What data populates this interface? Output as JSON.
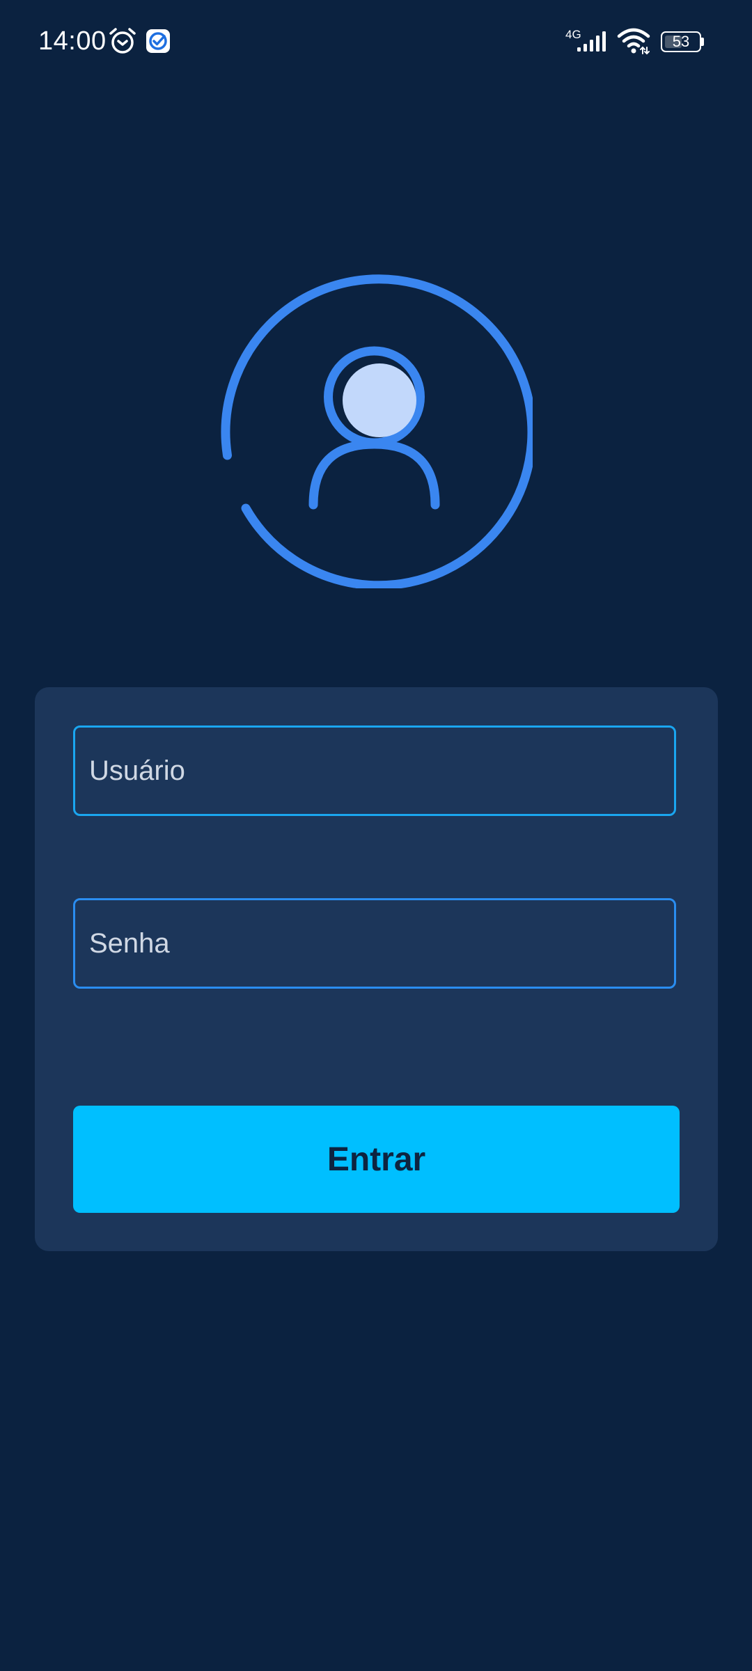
{
  "status_bar": {
    "time": "14:00",
    "network": "4G",
    "battery": 53,
    "icons": [
      "alarm-icon",
      "task-check-icon",
      "signal-icon",
      "wifi-icon",
      "battery-icon"
    ]
  },
  "avatar": {
    "icon": "user-profile-icon",
    "ring_color": "#3a86f0",
    "fill_color": "#c2d8fb"
  },
  "login_form": {
    "username_placeholder": "Usuário",
    "password_placeholder": "Senha",
    "submit_label": "Entrar"
  },
  "colors": {
    "background": "#0b2240",
    "card": "#1c365a",
    "input_border": "#1aa6f0",
    "button": "#00bfff",
    "button_text": "#0d2440"
  }
}
